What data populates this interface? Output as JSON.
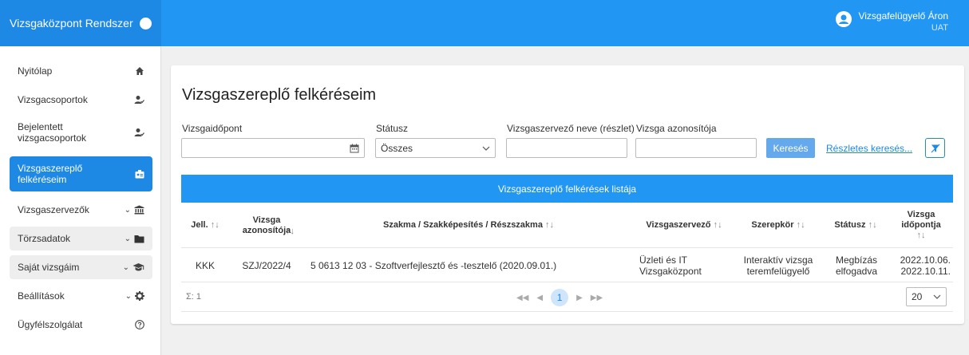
{
  "header": {
    "app_title": "Vizsgaközpont Rendszer",
    "user_name": "Vizsgafelügyelő Áron",
    "environment": "UAT"
  },
  "sidebar": {
    "items": [
      {
        "label": "Nyitólap",
        "icon": "home-icon"
      },
      {
        "label": "Vizsgacsoportok",
        "icon": "user-check-icon"
      },
      {
        "label": "Bejelentett vizsgacsoportok",
        "icon": "user-check-icon"
      },
      {
        "label": "Vizsgaszereplő felkéréseim",
        "icon": "id-badge-icon",
        "active": true
      },
      {
        "label": "Vizsgaszervezők",
        "icon": "institution-icon",
        "expandable": true
      },
      {
        "label": "Törzsadatok",
        "icon": "folder-icon",
        "expandable": true
      },
      {
        "label": "Saját vizsgáim",
        "icon": "graduation-cap-icon",
        "expandable": true
      },
      {
        "label": "Beállítások",
        "icon": "gear-icon",
        "expandable": true
      },
      {
        "label": "Ügyfélszolgálat",
        "icon": "help-circle-icon"
      }
    ]
  },
  "page": {
    "title": "Vizsgaszereplő felkéréseim"
  },
  "filters": {
    "date_label": "Vizsgaidőpont",
    "date_value": "",
    "status_label": "Státusz",
    "status_value": "Összes",
    "organizer_label": "Vizsgaszervező neve (részlet)",
    "organizer_value": "",
    "exam_id_label": "Vizsga azonosítója",
    "exam_id_value": "",
    "search_button": "Keresés",
    "detailed_search_link": "Részletes keresés..."
  },
  "table": {
    "title": "Vizsgaszereplő felkérések listája",
    "sort_glyph": "↑↓",
    "columns": [
      "Jell.",
      "Vizsga azonosítója",
      "Szakma / Szakképesítés / Részszakma",
      "Vizsgaszervező",
      "Szerepkör",
      "Státusz",
      "Vizsga időpontja"
    ],
    "rows": [
      {
        "jell": "KKK",
        "exam_id": "SZJ/2022/4",
        "profession": "5 0613 12 03 - Szoftverfejlesztő és -tesztelő (2020.09.01.)",
        "organizer": "Üzleti és IT Vizsgaközpont",
        "role": "Interaktív vizsga teremfelügyelő",
        "status": "Megbízás elfogadva",
        "date_from": "2022.10.06.",
        "date_to": "2022.10.11."
      }
    ],
    "sum_label": "Σ: 1",
    "current_page": "1",
    "page_size": "20"
  },
  "colors": {
    "primary": "#2196f3",
    "primary_dark": "#1e88e5",
    "search_button": "#64a9ec"
  }
}
